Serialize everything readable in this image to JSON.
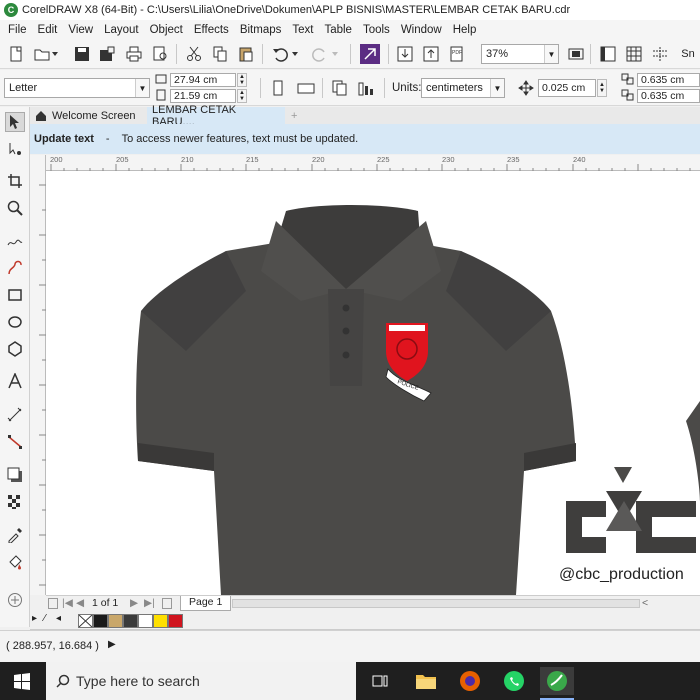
{
  "window": {
    "title": "CorelDRAW X8 (64-Bit) - C:\\Users\\Lilia\\OneDrive\\Dokumen\\APLP BISNIS\\MASTER\\LEMBAR CETAK BARU.cdr"
  },
  "menu": [
    "File",
    "Edit",
    "View",
    "Layout",
    "Object",
    "Effects",
    "Bitmaps",
    "Text",
    "Table",
    "Tools",
    "Window",
    "Help"
  ],
  "toolbar": {
    "zoom": "37%",
    "snap_label": "Sn"
  },
  "property_bar": {
    "page_size": "Letter",
    "width": "27.94 cm",
    "height": "21.59 cm",
    "units_label": "Units:",
    "units_value": "centimeters",
    "nudge": "0.025 cm",
    "dup_x": "0.635 cm",
    "dup_y": "0.635 cm"
  },
  "tabs": {
    "welcome": "Welcome Screen",
    "document": "LEMBAR CETAK BARU...."
  },
  "notification": {
    "title": "Update text",
    "dash": "-",
    "message": "To access newer features, text must be updated."
  },
  "ruler": {
    "h_ticks": [
      "200",
      "205",
      "210",
      "215",
      "220",
      "225",
      "230",
      "235",
      "240"
    ]
  },
  "canvas": {
    "shirt_color": "#4b4a48",
    "badge_text": "POLICE",
    "watermark_handle": "@cbc_production"
  },
  "page_nav": {
    "counter": "1 of 1",
    "page_tab": "Page 1"
  },
  "palette": {
    "colors": [
      "#1a1a1a",
      "#c9a76a",
      "#3b3b3b",
      "#ffffff",
      "#ffe000",
      "#d0141e"
    ]
  },
  "status": {
    "coordinates": "( 288.957, 16.684 )"
  },
  "taskbar": {
    "search_placeholder": "Type here to search"
  }
}
